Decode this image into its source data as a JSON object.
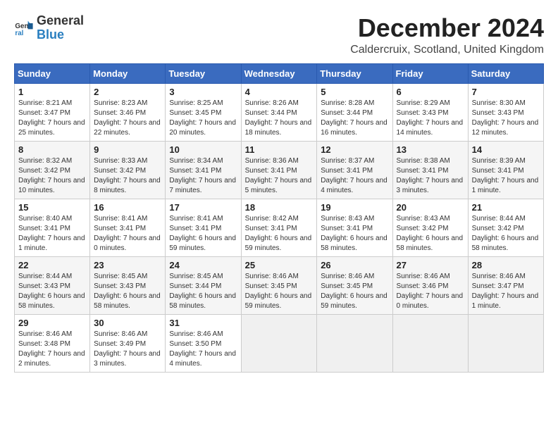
{
  "header": {
    "logo_line1": "General",
    "logo_line2": "Blue",
    "month_title": "December 2024",
    "location": "Caldercruix, Scotland, United Kingdom"
  },
  "weekdays": [
    "Sunday",
    "Monday",
    "Tuesday",
    "Wednesday",
    "Thursday",
    "Friday",
    "Saturday"
  ],
  "weeks": [
    [
      {
        "day": "1",
        "sunrise": "Sunrise: 8:21 AM",
        "sunset": "Sunset: 3:47 PM",
        "daylight": "Daylight: 7 hours and 25 minutes."
      },
      {
        "day": "2",
        "sunrise": "Sunrise: 8:23 AM",
        "sunset": "Sunset: 3:46 PM",
        "daylight": "Daylight: 7 hours and 22 minutes."
      },
      {
        "day": "3",
        "sunrise": "Sunrise: 8:25 AM",
        "sunset": "Sunset: 3:45 PM",
        "daylight": "Daylight: 7 hours and 20 minutes."
      },
      {
        "day": "4",
        "sunrise": "Sunrise: 8:26 AM",
        "sunset": "Sunset: 3:44 PM",
        "daylight": "Daylight: 7 hours and 18 minutes."
      },
      {
        "day": "5",
        "sunrise": "Sunrise: 8:28 AM",
        "sunset": "Sunset: 3:44 PM",
        "daylight": "Daylight: 7 hours and 16 minutes."
      },
      {
        "day": "6",
        "sunrise": "Sunrise: 8:29 AM",
        "sunset": "Sunset: 3:43 PM",
        "daylight": "Daylight: 7 hours and 14 minutes."
      },
      {
        "day": "7",
        "sunrise": "Sunrise: 8:30 AM",
        "sunset": "Sunset: 3:43 PM",
        "daylight": "Daylight: 7 hours and 12 minutes."
      }
    ],
    [
      {
        "day": "8",
        "sunrise": "Sunrise: 8:32 AM",
        "sunset": "Sunset: 3:42 PM",
        "daylight": "Daylight: 7 hours and 10 minutes."
      },
      {
        "day": "9",
        "sunrise": "Sunrise: 8:33 AM",
        "sunset": "Sunset: 3:42 PM",
        "daylight": "Daylight: 7 hours and 8 minutes."
      },
      {
        "day": "10",
        "sunrise": "Sunrise: 8:34 AM",
        "sunset": "Sunset: 3:41 PM",
        "daylight": "Daylight: 7 hours and 7 minutes."
      },
      {
        "day": "11",
        "sunrise": "Sunrise: 8:36 AM",
        "sunset": "Sunset: 3:41 PM",
        "daylight": "Daylight: 7 hours and 5 minutes."
      },
      {
        "day": "12",
        "sunrise": "Sunrise: 8:37 AM",
        "sunset": "Sunset: 3:41 PM",
        "daylight": "Daylight: 7 hours and 4 minutes."
      },
      {
        "day": "13",
        "sunrise": "Sunrise: 8:38 AM",
        "sunset": "Sunset: 3:41 PM",
        "daylight": "Daylight: 7 hours and 3 minutes."
      },
      {
        "day": "14",
        "sunrise": "Sunrise: 8:39 AM",
        "sunset": "Sunset: 3:41 PM",
        "daylight": "Daylight: 7 hours and 1 minute."
      }
    ],
    [
      {
        "day": "15",
        "sunrise": "Sunrise: 8:40 AM",
        "sunset": "Sunset: 3:41 PM",
        "daylight": "Daylight: 7 hours and 1 minute."
      },
      {
        "day": "16",
        "sunrise": "Sunrise: 8:41 AM",
        "sunset": "Sunset: 3:41 PM",
        "daylight": "Daylight: 7 hours and 0 minutes."
      },
      {
        "day": "17",
        "sunrise": "Sunrise: 8:41 AM",
        "sunset": "Sunset: 3:41 PM",
        "daylight": "Daylight: 6 hours and 59 minutes."
      },
      {
        "day": "18",
        "sunrise": "Sunrise: 8:42 AM",
        "sunset": "Sunset: 3:41 PM",
        "daylight": "Daylight: 6 hours and 59 minutes."
      },
      {
        "day": "19",
        "sunrise": "Sunrise: 8:43 AM",
        "sunset": "Sunset: 3:41 PM",
        "daylight": "Daylight: 6 hours and 58 minutes."
      },
      {
        "day": "20",
        "sunrise": "Sunrise: 8:43 AM",
        "sunset": "Sunset: 3:42 PM",
        "daylight": "Daylight: 6 hours and 58 minutes."
      },
      {
        "day": "21",
        "sunrise": "Sunrise: 8:44 AM",
        "sunset": "Sunset: 3:42 PM",
        "daylight": "Daylight: 6 hours and 58 minutes."
      }
    ],
    [
      {
        "day": "22",
        "sunrise": "Sunrise: 8:44 AM",
        "sunset": "Sunset: 3:43 PM",
        "daylight": "Daylight: 6 hours and 58 minutes."
      },
      {
        "day": "23",
        "sunrise": "Sunrise: 8:45 AM",
        "sunset": "Sunset: 3:43 PM",
        "daylight": "Daylight: 6 hours and 58 minutes."
      },
      {
        "day": "24",
        "sunrise": "Sunrise: 8:45 AM",
        "sunset": "Sunset: 3:44 PM",
        "daylight": "Daylight: 6 hours and 58 minutes."
      },
      {
        "day": "25",
        "sunrise": "Sunrise: 8:46 AM",
        "sunset": "Sunset: 3:45 PM",
        "daylight": "Daylight: 6 hours and 59 minutes."
      },
      {
        "day": "26",
        "sunrise": "Sunrise: 8:46 AM",
        "sunset": "Sunset: 3:45 PM",
        "daylight": "Daylight: 6 hours and 59 minutes."
      },
      {
        "day": "27",
        "sunrise": "Sunrise: 8:46 AM",
        "sunset": "Sunset: 3:46 PM",
        "daylight": "Daylight: 7 hours and 0 minutes."
      },
      {
        "day": "28",
        "sunrise": "Sunrise: 8:46 AM",
        "sunset": "Sunset: 3:47 PM",
        "daylight": "Daylight: 7 hours and 1 minute."
      }
    ],
    [
      {
        "day": "29",
        "sunrise": "Sunrise: 8:46 AM",
        "sunset": "Sunset: 3:48 PM",
        "daylight": "Daylight: 7 hours and 2 minutes."
      },
      {
        "day": "30",
        "sunrise": "Sunrise: 8:46 AM",
        "sunset": "Sunset: 3:49 PM",
        "daylight": "Daylight: 7 hours and 3 minutes."
      },
      {
        "day": "31",
        "sunrise": "Sunrise: 8:46 AM",
        "sunset": "Sunset: 3:50 PM",
        "daylight": "Daylight: 7 hours and 4 minutes."
      },
      null,
      null,
      null,
      null
    ]
  ]
}
